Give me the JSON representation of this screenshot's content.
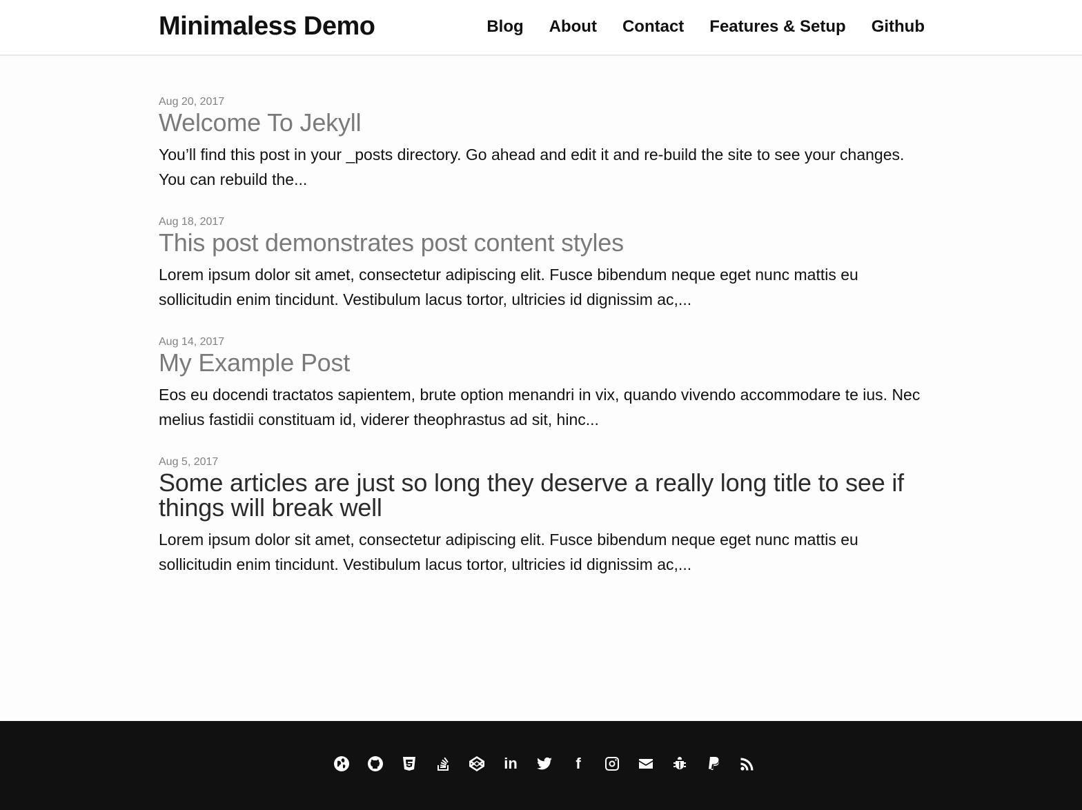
{
  "header": {
    "site_title": "Minimaless Demo",
    "nav": [
      "Blog",
      "About",
      "Contact",
      "Features & Setup",
      "Github"
    ]
  },
  "posts": [
    {
      "date": "Aug 20, 2017",
      "title": "Welcome To Jekyll",
      "excerpt": "You’ll find this post in your _posts directory. Go ahead and edit it and re-build the site to see your changes. You can rebuild the..."
    },
    {
      "date": "Aug 18, 2017",
      "title": "This post demonstrates post content styles",
      "excerpt": "Lorem ipsum dolor sit amet, consectetur adipiscing elit. Fusce bibendum neque eget nunc mattis eu sollicitudin enim tincidunt. Vestibulum lacus tortor, ultricies id dignissim ac,..."
    },
    {
      "date": "Aug 14, 2017",
      "title": "My Example Post",
      "excerpt": "Eos eu docendi tractatos sapientem, brute option menandri in vix, quando vivendo accommodare te ius. Nec melius fastidii constituam id, viderer theophrastus ad sit, hinc..."
    },
    {
      "date": "Aug 5, 2017",
      "title": "Some articles are just so long they deserve a really long title to see if things will break well",
      "excerpt": "Lorem ipsum dolor sit amet, consectetur adipiscing elit. Fusce bibendum neque eget nunc mattis eu sollicitudin enim tincidunt. Vestibulum lacus tortor, ultricies id dignissim ac,..."
    }
  ],
  "footer": {
    "social_icons": [
      "globe-icon",
      "github-icon",
      "html5-icon",
      "stackoverflow-icon",
      "codepen-icon",
      "linkedin-icon",
      "twitter-icon",
      "facebook-icon",
      "instagram-icon",
      "email-icon",
      "bug-icon",
      "paypal-icon",
      "rss-icon"
    ],
    "linkedin_text": "in",
    "facebook_text": "f"
  },
  "colors": {
    "background": "#fdfdfd",
    "footer": "#111111",
    "visited_title": "#7a7a7a",
    "title_dark": "#2b2b2b"
  }
}
